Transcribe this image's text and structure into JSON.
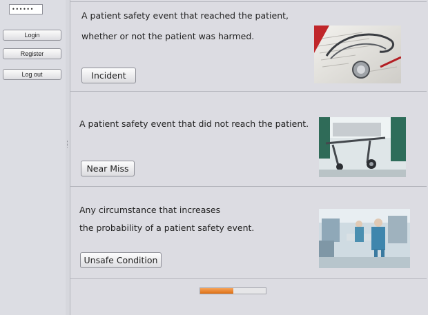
{
  "sidebar": {
    "password_mask": "••••••",
    "login_label": "Login",
    "register_label": "Register",
    "logout_label": "Log out"
  },
  "events": [
    {
      "lines": [
        "A patient safety event that reached the patient,",
        "whether or not the patient was harmed."
      ],
      "button_label": "Incident",
      "image": "stethoscope-on-documents"
    },
    {
      "lines": [
        "A patient safety event that did not reach the patient."
      ],
      "button_label": "Near Miss",
      "image": "hospital-gurney-corridor"
    },
    {
      "lines": [
        "Any circumstance that increases",
        "the probability of a patient safety event."
      ],
      "button_label": "Unsafe Condition",
      "image": "operating-room-staff"
    }
  ],
  "progress": {
    "value": 0.5,
    "color": "#e57a1e"
  }
}
